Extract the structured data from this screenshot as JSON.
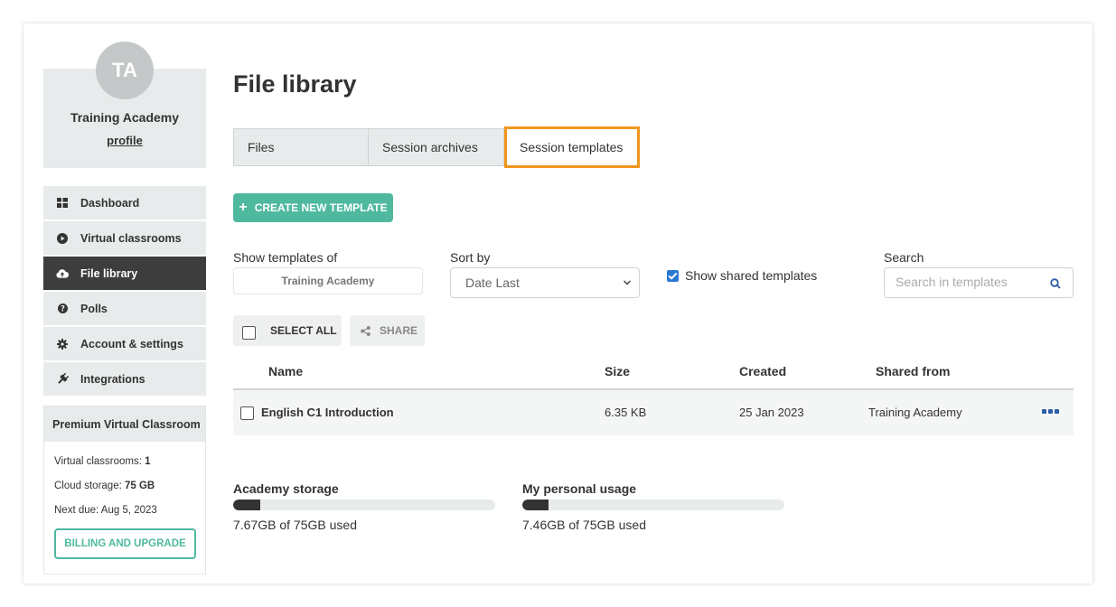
{
  "sidebar": {
    "avatar_initials": "TA",
    "org_name": "Training Academy",
    "profile_link": "profile",
    "nav": [
      {
        "label": "Dashboard",
        "icon": "grid-icon"
      },
      {
        "label": "Virtual classrooms",
        "icon": "play-circle-icon"
      },
      {
        "label": "File library",
        "icon": "cloud-upload-icon",
        "active": true
      },
      {
        "label": "Polls",
        "icon": "question-circle-icon"
      },
      {
        "label": "Account & settings",
        "icon": "gear-icon"
      },
      {
        "label": "Integrations",
        "icon": "plug-icon"
      }
    ],
    "plan": {
      "title": "Premium Virtual Classroom",
      "classrooms_label": "Virtual classrooms:",
      "classrooms_value": "1",
      "storage_label": "Cloud storage:",
      "storage_value": "75 GB",
      "next_due": "Next due: Aug 5, 2023",
      "billing_button": "BILLING AND UPGRADE"
    }
  },
  "main": {
    "title": "File library",
    "tabs": [
      {
        "label": "Files"
      },
      {
        "label": "Session archives"
      },
      {
        "label": "Session templates",
        "active": true
      }
    ],
    "create_button": "CREATE NEW TEMPLATE",
    "filters": {
      "owner_label": "Show templates of",
      "owner_value": "Training Academy",
      "sort_label": "Sort by",
      "sort_value": "Date Last",
      "shared_label": "Show shared templates",
      "shared_checked": true,
      "search_label": "Search",
      "search_placeholder": "Search in templates"
    },
    "actions": {
      "select_all": "SELECT ALL",
      "share": "SHARE"
    },
    "table": {
      "columns": [
        "Name",
        "Size",
        "Created",
        "Shared from"
      ],
      "rows": [
        {
          "name": "English C1 Introduction",
          "size": "6.35 KB",
          "created": "25 Jan 2023",
          "shared_from": "Training Academy"
        }
      ]
    },
    "storage": {
      "academy_title": "Academy storage",
      "academy_text": "7.67GB of 75GB used",
      "academy_fraction": 0.102,
      "personal_title": "My personal usage",
      "personal_text": "7.46GB of 75GB used",
      "personal_fraction": 0.099
    }
  },
  "colors": {
    "accent": "#4fb99f",
    "active_tab_border": "#f0961e",
    "nav_active": "#3d3d3d",
    "checkbox": "#2a78d4",
    "more_dots": "#2a5ea8"
  }
}
